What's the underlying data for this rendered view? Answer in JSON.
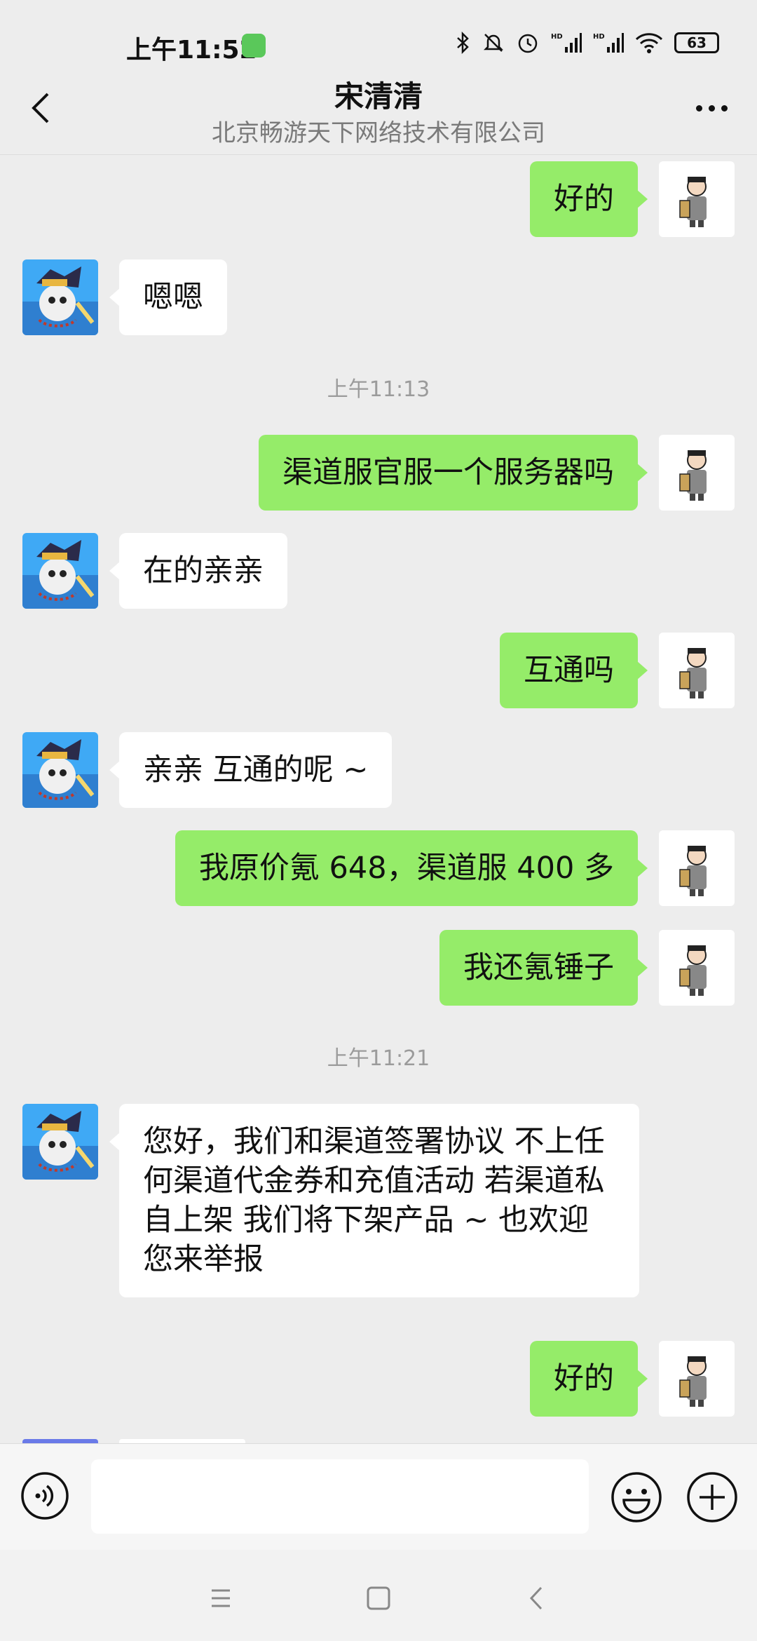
{
  "status_bar": {
    "time": "上午11:52",
    "battery": "63",
    "indicators": [
      "bluetooth-icon",
      "mute-icon",
      "alarm-icon",
      "hd-signal-icon",
      "hd-signal-icon",
      "wifi-icon"
    ]
  },
  "header": {
    "title": "宋清清",
    "subtitle": "北京畅游天下网络技术有限公司"
  },
  "messages": [
    {
      "side": "out",
      "text": "好的"
    },
    {
      "side": "in",
      "text": "嗯嗯"
    },
    {
      "side": "time",
      "text": "上午11:13"
    },
    {
      "side": "out",
      "text": "渠道服官服一个服务器吗"
    },
    {
      "side": "in",
      "text": "在的亲亲"
    },
    {
      "side": "out",
      "text": "互通吗"
    },
    {
      "side": "in",
      "text": "亲亲 互通的呢 ~"
    },
    {
      "side": "out",
      "text": "我原价氪 648，渠道服 400 多"
    },
    {
      "side": "out",
      "text": "我还氪锤子"
    },
    {
      "side": "time",
      "text": "上午11:21"
    },
    {
      "side": "in",
      "text": "您好，我们和渠道签署协议 不上任何渠道代金券和充值活动 若渠道私自上架 我们将下架产品 ~ 也欢迎您来举报"
    },
    {
      "side": "out",
      "text": "好的"
    }
  ],
  "input": {
    "value": ""
  },
  "colors": {
    "background": "#ededed",
    "outgoing_bubble": "#95ec69",
    "incoming_bubble": "#ffffff"
  }
}
